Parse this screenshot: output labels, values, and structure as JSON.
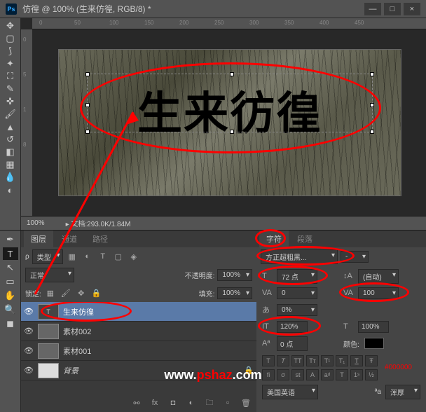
{
  "title": "仿徨 @ 100% (生来仿徨, RGB/8) *",
  "canvas_text": "生来彷徨",
  "status": {
    "zoom": "100%",
    "doc": "文档:293.0K/1.84M"
  },
  "ruler_h": [
    "0",
    "50",
    "100",
    "150",
    "200",
    "250",
    "300",
    "350",
    "400",
    "450"
  ],
  "ruler_v": [
    "0",
    "5",
    "1",
    "8"
  ],
  "layers_panel": {
    "tabs": [
      "图层",
      "通道",
      "路径"
    ],
    "kind_label": "类型",
    "blend": "正常",
    "opacity_label": "不透明度:",
    "opacity": "100%",
    "lock_label": "锁定:",
    "fill_label": "填充:",
    "fill": "100%",
    "layers": [
      {
        "name": "生来仿徨",
        "type": "T",
        "active": true
      },
      {
        "name": "素材002",
        "type": "img"
      },
      {
        "name": "素材001",
        "type": "img"
      },
      {
        "name": "背景",
        "type": "bg",
        "locked": true
      }
    ]
  },
  "char_panel": {
    "tabs": [
      "字符",
      "段落"
    ],
    "font": "方正超粗黑...",
    "size_label": "T",
    "size": "72 点",
    "leading_label": "A",
    "leading": "(自动)",
    "kerning_label": "VA",
    "kerning": "0",
    "tracking_label": "VA",
    "tracking": "100",
    "baseline_label": "あ",
    "baseline": "0%",
    "vscale_label": "T",
    "vscale": "120%",
    "hscale_label": "T",
    "hscale": "100%",
    "shift_label": "Aa",
    "shift": "0 点",
    "color_label": "颜色:",
    "lang": "美国英语",
    "aa": "浑厚"
  },
  "hex": "#000000",
  "watermark": {
    "p1": "www.",
    "p2": "pshaz",
    "p3": ".com"
  }
}
